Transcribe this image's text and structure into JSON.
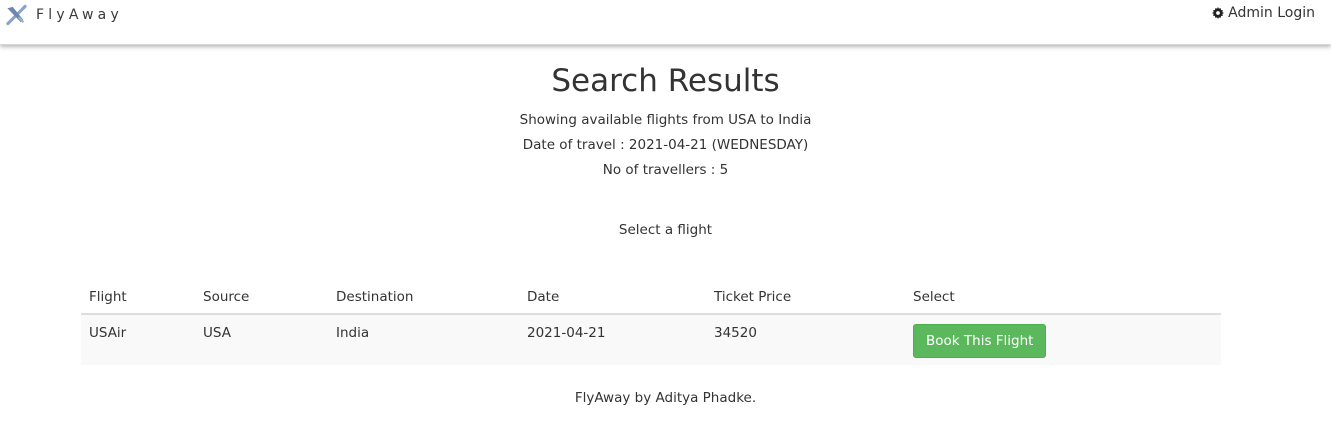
{
  "app": {
    "brand_name": "FlyAway",
    "admin_link": "Admin Login",
    "icons": {
      "brand": "airplane-icon",
      "admin": "gear-icon"
    }
  },
  "page": {
    "title": "Search Results",
    "route_line": "Showing available flights from USA to India",
    "date_line": "Date of travel : 2021-04-21 (WEDNESDAY)",
    "travellers_line": "No of travellers : 5",
    "select_prompt": "Select a flight"
  },
  "table": {
    "headers": [
      "Flight",
      "Source",
      "Destination",
      "Date",
      "Ticket Price",
      "Select"
    ],
    "rows": [
      {
        "flight": "USAir",
        "source": "USA",
        "destination": "India",
        "date": "2021-04-21",
        "price": "34520",
        "action": "Book This Flight"
      }
    ]
  },
  "footer": {
    "text": "FlyAway by Aditya Phadke."
  },
  "colors": {
    "accent_button": "#5cb85c",
    "text": "#333333",
    "row_stripe": "#f9f9f9"
  }
}
